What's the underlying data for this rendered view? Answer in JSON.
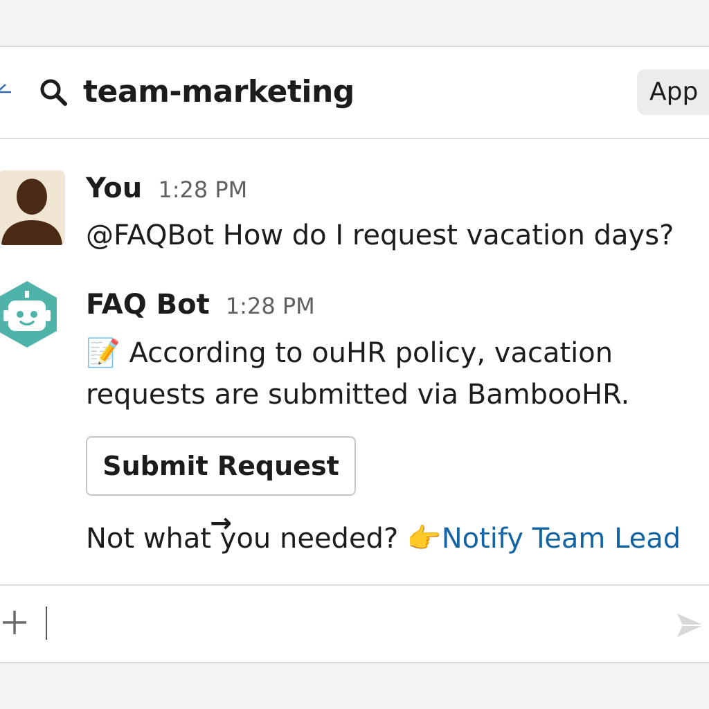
{
  "header": {
    "channel_name": "team-marketing",
    "app_label": "App",
    "back_icon": "back-arrow-icon",
    "search_icon": "search-icon"
  },
  "messages": [
    {
      "sender": "You",
      "time": "1:28 PM",
      "text": "@FAQBot How do I request vacation days?",
      "avatar": "user-avatar"
    },
    {
      "sender": "FAQ Bot",
      "time": "1:28 PM",
      "text_line1": "📝 According to ouHR policy, vacation",
      "text_line2": "requests are submitted via BambooHR.",
      "avatar": "bot-avatar",
      "button_label": "Submit Request →",
      "notify_prefix": "Not what you needed? 👉",
      "notify_link": "Notify Team Lead"
    }
  ],
  "composer": {
    "plus_icon": "plus-icon",
    "send_icon": "send-icon",
    "value": ""
  },
  "colors": {
    "link": "#1264a3",
    "bot_avatar": "#4fb3a9",
    "user_avatar_bg": "#f1e6d4",
    "user_avatar_fg": "#4a2a14"
  }
}
